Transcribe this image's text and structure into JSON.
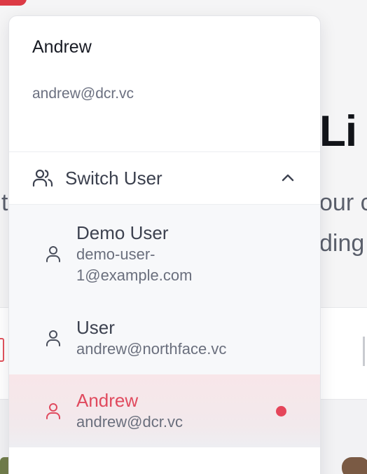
{
  "current_user": {
    "name": "Andrew",
    "email": "andrew@dcr.vc"
  },
  "switch": {
    "label": "Switch User",
    "icon": "users-icon",
    "state_icon": "chevron-up-icon"
  },
  "users": [
    {
      "name": "Demo User",
      "email": "demo-user-1@example.com",
      "active": false,
      "icon": "person-icon"
    },
    {
      "name": "User",
      "email": "andrew@northface.vc",
      "active": false,
      "icon": "person-icon"
    },
    {
      "name": "Andrew",
      "email": "andrew@dcr.vc",
      "active": true,
      "icon": "person-icon"
    }
  ],
  "background": {
    "heading_fragment": "Li",
    "line_1_fragment": "our c",
    "line_2_fragment": "ding",
    "left_fragment": "t"
  },
  "colors": {
    "accent": "#e5455a",
    "active_text": "#e04a5e",
    "active_bg": "#f8e6e9"
  }
}
